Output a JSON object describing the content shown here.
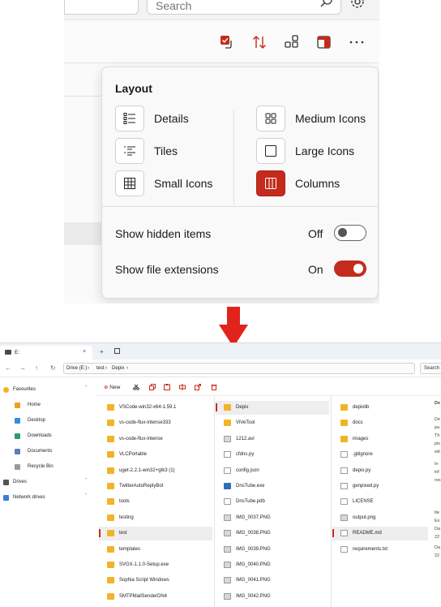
{
  "top": {
    "search_placeholder": "Search",
    "popup": {
      "title": "Layout",
      "options": [
        {
          "label": "Details",
          "icon": "details-view-icon",
          "active": false
        },
        {
          "label": "Tiles",
          "icon": "tiles-view-icon",
          "active": false
        },
        {
          "label": "Small Icons",
          "icon": "small-icons-view-icon",
          "active": false
        },
        {
          "label": "Medium Icons",
          "icon": "medium-icons-view-icon",
          "active": false
        },
        {
          "label": "Large Icons",
          "icon": "large-icons-view-icon",
          "active": false
        },
        {
          "label": "Columns",
          "icon": "columns-view-icon",
          "active": true
        }
      ],
      "toggles": [
        {
          "label": "Show hidden items",
          "state": "Off"
        },
        {
          "label": "Show file extensions",
          "state": "On"
        }
      ]
    },
    "accent": "#c42b1c"
  },
  "explorer": {
    "tab_title": "E:",
    "tab_close": "×",
    "new_tab": "+",
    "breadcrumb": [
      "Drive (E:)",
      "test",
      "Depix"
    ],
    "search_label": "Search",
    "new_label": "New",
    "sidebar": [
      {
        "label": "Favourites",
        "icon": "star-icon"
      },
      {
        "label": "Home",
        "icon": "home-icon"
      },
      {
        "label": "Desktop",
        "icon": "desktop-icon"
      },
      {
        "label": "Downloads",
        "icon": "download-icon"
      },
      {
        "label": "Documents",
        "icon": "documents-icon"
      },
      {
        "label": "Recycle Bin",
        "icon": "recycle-bin-icon"
      },
      {
        "label": "Drives",
        "icon": "drive-icon"
      },
      {
        "label": "Network drives",
        "icon": "network-icon"
      }
    ],
    "col1": [
      "VSCode-win32-x64-1.59.1",
      "vs-code-flux-intense333",
      "vs-code-flux-intense",
      "VLCPortable",
      "uget-2.2.1-win32+gtk3 (1)",
      "TwitterAutoReplyBot",
      "tools",
      "testing",
      "test",
      "templates",
      "SVGX-1.1.0-Setup.exe",
      "Sophia Script Windows",
      "SMTPMailSenderDN4"
    ],
    "col2": [
      "Depix",
      "ViVeTool",
      "1212.avi",
      "cfdns.py",
      "config.json",
      "DnsTube.exe",
      "DnsTube.pdb",
      "IMG_0037.PNG",
      "IMG_0038.PNG",
      "IMG_0039.PNG",
      "IMG_0040.PNG",
      "IMG_0041.PNG",
      "IMG_0042.PNG"
    ],
    "col3": [
      "depixlib",
      "docs",
      "images",
      ".gitignore",
      "depix.py",
      "genpixed.py",
      "LICENSE",
      "output.png",
      "README.md",
      "requirements.txt"
    ],
    "preview_fragments": [
      "De",
      "De",
      "pa",
      "Th",
      "pix",
      "wit",
      "In",
      "inf",
      "res",
      "Ite",
      "Ex",
      "Da",
      "22",
      "Da",
      "22"
    ]
  }
}
